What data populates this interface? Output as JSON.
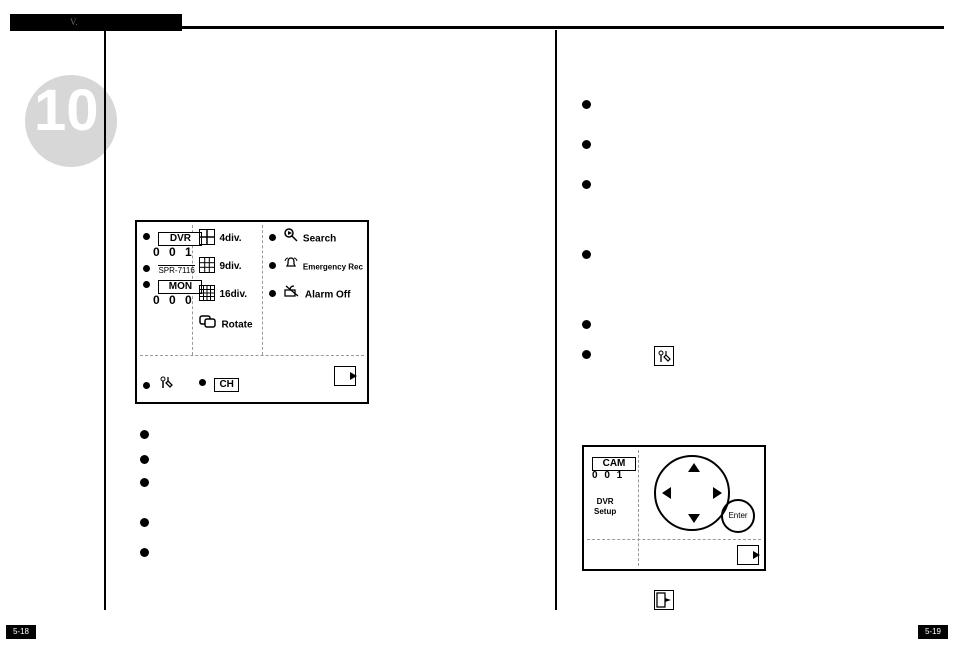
{
  "header": {
    "section_marker": "V."
  },
  "page_number_circle": "10",
  "footer": {
    "left_page": "5-18",
    "right_page": "5-19"
  },
  "panel": {
    "dvr_tag": "DVR",
    "dvr_num": "0 0 1",
    "model": "SPR-7116",
    "mon_tag": "MON",
    "mon_num": "0 0 0",
    "div4": "4div.",
    "div9": "9div.",
    "div16": "16div.",
    "rotate": "Rotate",
    "search": "Search",
    "emerg": "Emergency Rec",
    "alarmoff": "Alarm Off",
    "ch": "CH"
  },
  "dvrsetup": {
    "cam_tag": "CAM",
    "cam_num": "0 0 1",
    "label": "DVR\nSetup",
    "enter": "Enter"
  }
}
